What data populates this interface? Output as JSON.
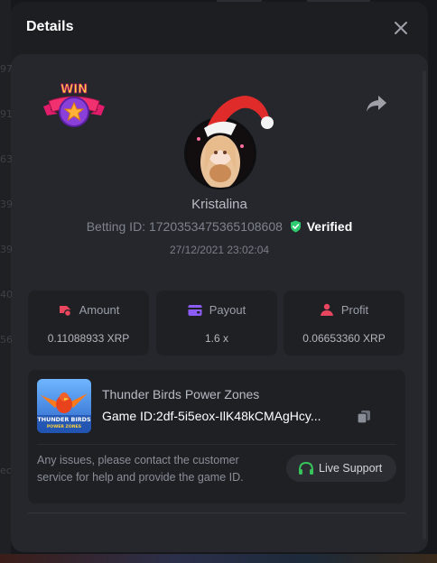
{
  "modal": {
    "title": "Details"
  },
  "player": {
    "username": "Kristalina",
    "betting_id_label": "Betting ID:",
    "betting_id": "1720353475365108608",
    "verified_label": "Verified",
    "timestamp": "27/12/2021 23:02:04"
  },
  "badge": {
    "text": "WIN"
  },
  "stats": [
    {
      "label": "Amount",
      "value": "0.11088933 XRP",
      "icon": "amount-icon",
      "icon_color": "#e8455e"
    },
    {
      "label": "Payout",
      "value": "1.6 x",
      "icon": "wallet-icon",
      "icon_color": "#8b5cf6"
    },
    {
      "label": "Profit",
      "value": "0.06653360 XRP",
      "icon": "profit-icon",
      "icon_color": "#e8455e"
    }
  ],
  "game": {
    "name": "Thunder Birds Power Zones",
    "id_label": "Game ID:",
    "id_value": "2df-5i5eox-IlK48kCMAgHcy...",
    "thumb_title": "THUNDER BIRDS",
    "thumb_subtitle": "POWER ZONES"
  },
  "support": {
    "issue_text": "Any issues, please contact the customer service for help and provide the game ID.",
    "button_label": "Live Support"
  },
  "colors": {
    "background": "#1d1e22",
    "panel": "#25272c",
    "card": "#1e2024",
    "verified_green": "#2ecc71",
    "support_green": "#37c45a"
  },
  "icons": {
    "close": "close-icon",
    "share": "share-icon",
    "shield": "shield-check-icon",
    "copy": "copy-icon",
    "headset": "headset-icon"
  }
}
